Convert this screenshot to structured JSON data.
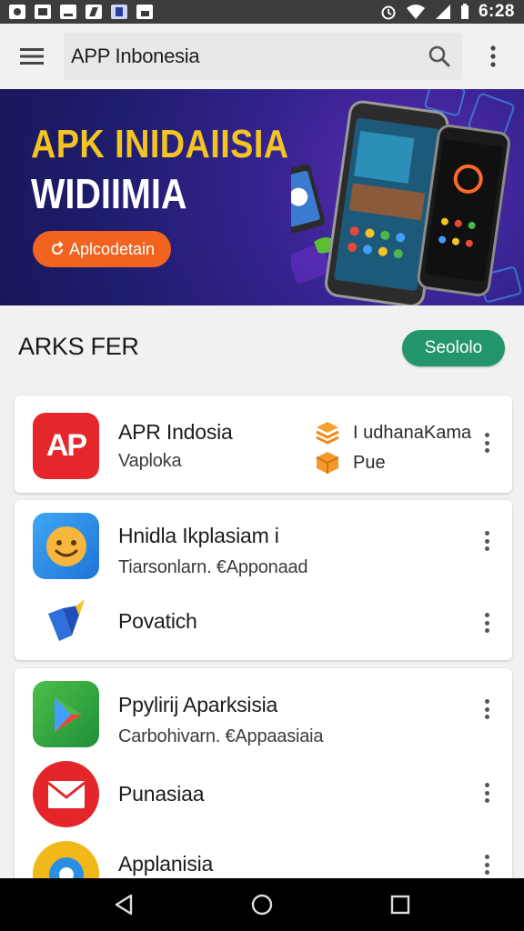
{
  "status_bar": {
    "time": "6:28",
    "left_icons": [
      "notification-icon",
      "notification-icon",
      "notification-icon",
      "notification-icon",
      "notification-icon",
      "notification-icon"
    ],
    "right_icons": [
      "alarm-icon",
      "wifi-icon",
      "signal-icon",
      "battery-icon"
    ]
  },
  "app_bar": {
    "search_text": "APP Inbonesia"
  },
  "banner": {
    "title_line1": "APK INIDAIISIA",
    "title_line2": "WIDIIMIA",
    "button_label": "Aplcodetain",
    "colors": {
      "background": "#22206f",
      "title": "#f3c422",
      "button": "#f0641f"
    }
  },
  "section": {
    "title": "ARKS FER",
    "button_label": "Seololo",
    "button_color": "#22966a"
  },
  "cards": [
    {
      "rows": [
        {
          "name": "APR Indosia",
          "subtitle": "Vaploka",
          "icon": "ap-logo-icon",
          "icon_color": "#e5262b",
          "meta": [
            {
              "icon": "layers-icon",
              "text": "I udhanaKama"
            },
            {
              "icon": "box-icon",
              "text": "Pue"
            }
          ]
        }
      ]
    },
    {
      "rows": [
        {
          "name": "Hnidla Ikplasiam i",
          "subtitle": "Tiarsonlarn. €Apponaad",
          "icon": "smiley-icon",
          "icon_color": "#2a90e6"
        },
        {
          "name": "Povatich",
          "subtitle": "",
          "icon": "arrow-logo-icon",
          "icon_color": "#2f6fdc"
        }
      ]
    },
    {
      "rows": [
        {
          "name": "Ppylirij Aparksisia",
          "subtitle": "Carbohivarn. €Appaasiaia",
          "icon": "play-store-icon",
          "icon_color": "#2c9e3e"
        },
        {
          "name": "Punasiaa",
          "subtitle": "",
          "icon": "mail-icon",
          "icon_color": "#e4262b"
        },
        {
          "name": "Applanisia",
          "subtitle": "",
          "icon": "location-icon",
          "icon_color": "#f2b81a"
        }
      ]
    }
  ],
  "nav_bar": {
    "buttons": [
      "back-icon",
      "home-icon",
      "recents-icon"
    ]
  }
}
